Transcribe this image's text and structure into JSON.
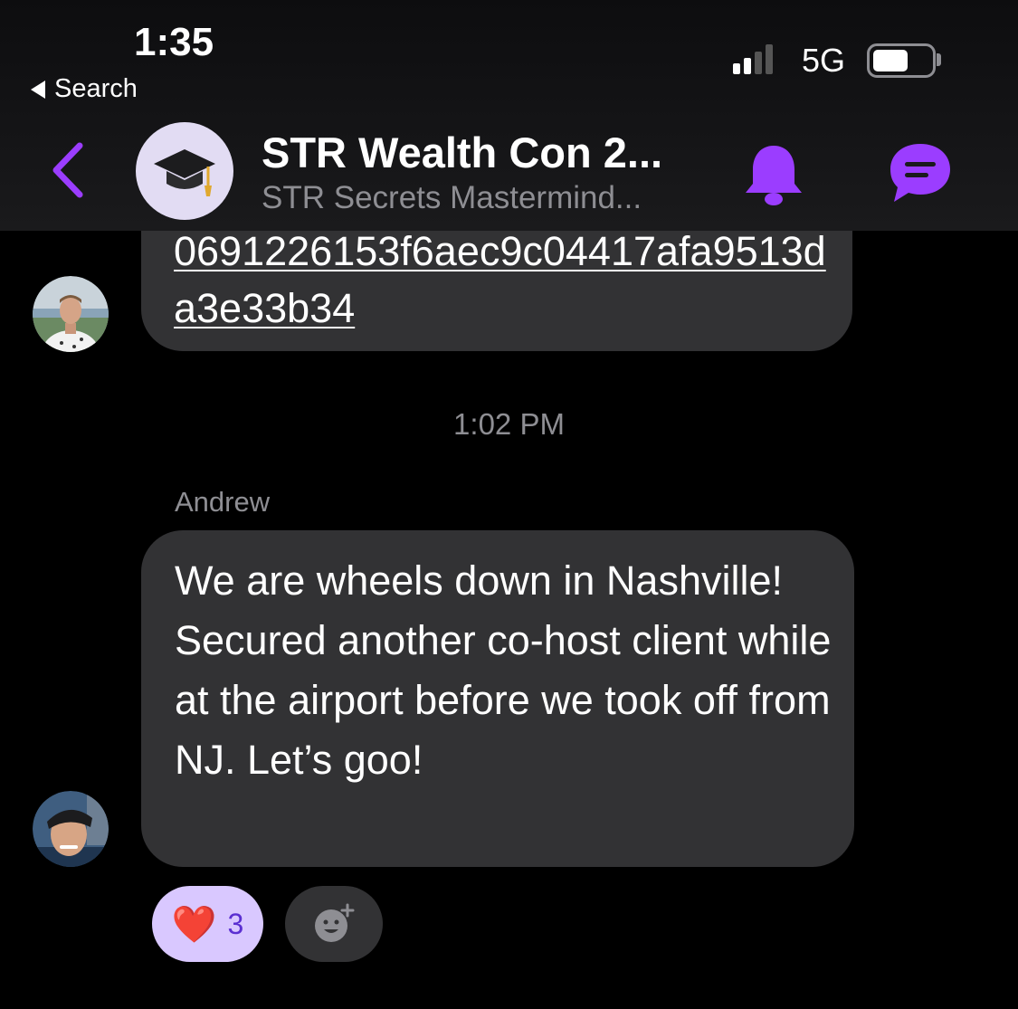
{
  "status_bar": {
    "time": "1:35",
    "back_label": "Search",
    "network": "5G"
  },
  "header": {
    "title": "STR Wealth Con 2...",
    "subtitle": "STR Secrets Mastermind...",
    "avatar_icon": "graduation-cap-icon",
    "accent_color": "#9b3dff"
  },
  "messages": {
    "link_message": {
      "text": "0691226153f6aec9c04417afa9513da3e33b34"
    },
    "time_divider": "1:02 PM",
    "andrew_message": {
      "sender": "Andrew",
      "text": "We are wheels down in Nashville! Secured another co-host client while at the airport before we took off from NJ. Let’s goo!"
    },
    "reactions": {
      "heart_emoji": "❤️",
      "heart_count": "3",
      "add_icon": "add-reaction-icon"
    }
  },
  "colors": {
    "bubble": "#323234",
    "background": "#000000",
    "reaction_bg": "#d9c8ff"
  }
}
